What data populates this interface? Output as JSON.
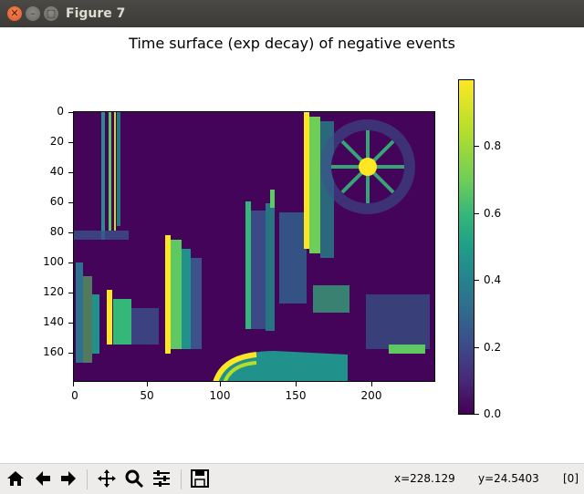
{
  "window": {
    "title": "Figure 7"
  },
  "plot": {
    "title": "Time surface (exp decay) of negative events",
    "x_ticks": [
      "0",
      "50",
      "100",
      "150",
      "200"
    ],
    "y_ticks": [
      "0",
      "20",
      "40",
      "60",
      "80",
      "100",
      "120",
      "140",
      "160"
    ],
    "colorbar_ticks": [
      "0.0",
      "0.2",
      "0.4",
      "0.6",
      "0.8"
    ]
  },
  "chart_data": {
    "type": "heatmap",
    "title": "Time surface (exp decay) of negative events",
    "xlim": [
      0,
      240
    ],
    "ylim": [
      180,
      0
    ],
    "colormap": "viridis",
    "value_range": [
      0.0,
      1.0
    ]
  },
  "status": {
    "x": "x=228.129",
    "y": "y=24.5403",
    "index": "[0]"
  },
  "toolbar": {
    "buttons": [
      "home-icon",
      "back-icon",
      "forward-icon",
      "pan-icon",
      "zoom-icon",
      "configure-subplots-icon",
      "save-icon"
    ]
  },
  "colors": {
    "background": "#44045a",
    "high": "#fde725",
    "mid": "#21918c"
  }
}
